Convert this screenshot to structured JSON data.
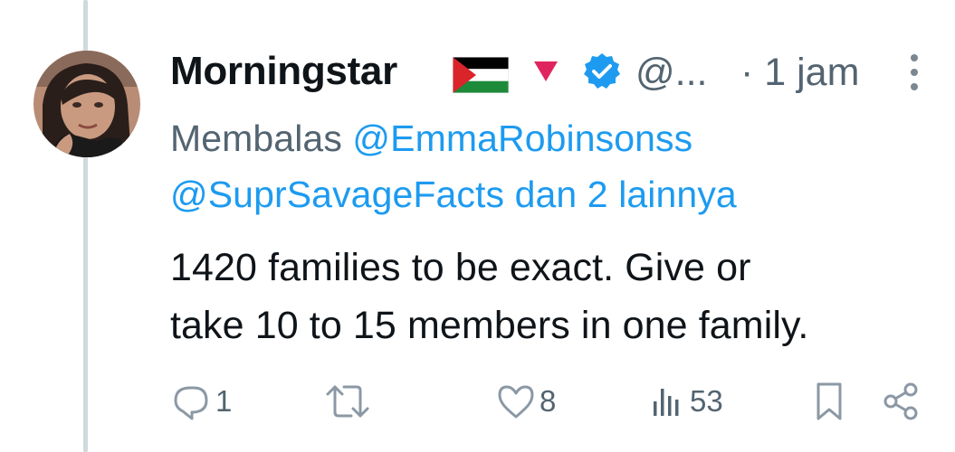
{
  "tweet": {
    "author_name": "Morningstar",
    "handle": "@...",
    "time": "· 1 jam",
    "reply_prefix": "Membalas ",
    "mention_1": "@EmmaRobinsonss",
    "mention_2": "@SuprSavageFacts dan 2 lainnya",
    "body_line_1": "1420 families to be exact. Give or",
    "body_line_2": "take 10 to 15 members in one family."
  },
  "actions": {
    "reply_count": "1",
    "retweet_count": "",
    "like_count": "8",
    "views_count": "53"
  },
  "icons": {
    "flag": "palestine-flag-icon",
    "triangle": "red-triangle-icon",
    "verified": "verified-badge-icon",
    "more": "more-vertical-icon",
    "reply": "reply-icon",
    "retweet": "retweet-icon",
    "like": "heart-icon",
    "views": "views-icon",
    "bookmark": "bookmark-icon",
    "share": "share-icon"
  },
  "colors": {
    "accent": "#1d9bf0",
    "secondary_text": "#536471",
    "primary_text": "#0f1419",
    "triangle": "#e0245e"
  }
}
